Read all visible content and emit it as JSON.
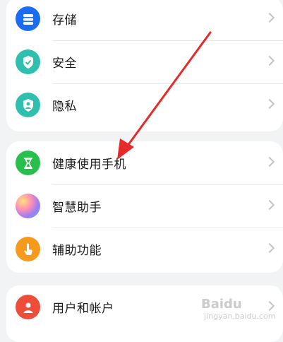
{
  "groups": [
    {
      "items": [
        {
          "label": "存储",
          "icon": "storage-icon",
          "color": "#1a6cf5"
        },
        {
          "label": "安全",
          "icon": "shield-check-icon",
          "color": "#2fbfae"
        },
        {
          "label": "隐私",
          "icon": "privacy-shield-icon",
          "color": "#2fbfae"
        }
      ]
    },
    {
      "items": [
        {
          "label": "健康使用手机",
          "icon": "hourglass-icon",
          "color": "#28c04c"
        },
        {
          "label": "智慧助手",
          "icon": "assistant-orb-icon",
          "color": "#a98cf6"
        },
        {
          "label": "辅助功能",
          "icon": "hand-pointer-icon",
          "color": "#f59a1b"
        }
      ]
    },
    {
      "items": [
        {
          "label": "用户和帐户",
          "icon": "user-icon",
          "color": "#ee4d3a"
        }
      ]
    }
  ],
  "annotation_color": "#e8292a",
  "watermark": {
    "brand": "Baidu",
    "sub": "jingyan.baidu.com"
  }
}
